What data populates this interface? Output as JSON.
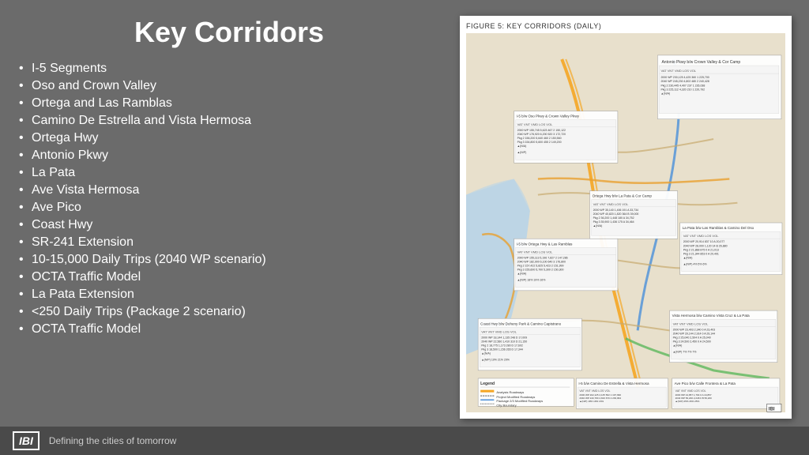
{
  "title": "Key Corridors",
  "bullets": [
    {
      "level": 1,
      "text": "I-5 Segments",
      "children": [
        {
          "level": 2,
          "text": "Oso and Crown Valley"
        },
        {
          "level": 2,
          "text": "Ortega and Las Ramblas"
        },
        {
          "level": 2,
          "text": "Camino De Estrella and Vista Hermosa"
        }
      ]
    },
    {
      "level": 1,
      "text": "Ortega Hwy"
    },
    {
      "level": 1,
      "text": "Antonio Pkwy"
    },
    {
      "level": 1,
      "text": "La Pata"
    },
    {
      "level": 1,
      "text": "Ave Vista Hermosa"
    },
    {
      "level": 1,
      "text": "Ave Pico"
    },
    {
      "level": 1,
      "text": "Coast Hwy"
    },
    {
      "level": 1,
      "text": "SR-241 Extension",
      "children": [
        {
          "level": 2,
          "text": "10-15,000 Daily Trips (2040 WP scenario)"
        },
        {
          "level": 3,
          "text": "OCTA Traffic Model"
        }
      ]
    },
    {
      "level": 1,
      "text": "La Pata Extension",
      "children": [
        {
          "level": 2,
          "text": "<250 Daily Trips (Package 2 scenario)"
        },
        {
          "level": 3,
          "text": "OCTA Traffic Model"
        }
      ]
    }
  ],
  "map": {
    "title": "FIGURE 5: KEY CORRIDORS (DAILY)",
    "ib_label": "IBI"
  },
  "footer": {
    "logo": "IBI",
    "tagline": "Defining the cities of tomorrow"
  }
}
